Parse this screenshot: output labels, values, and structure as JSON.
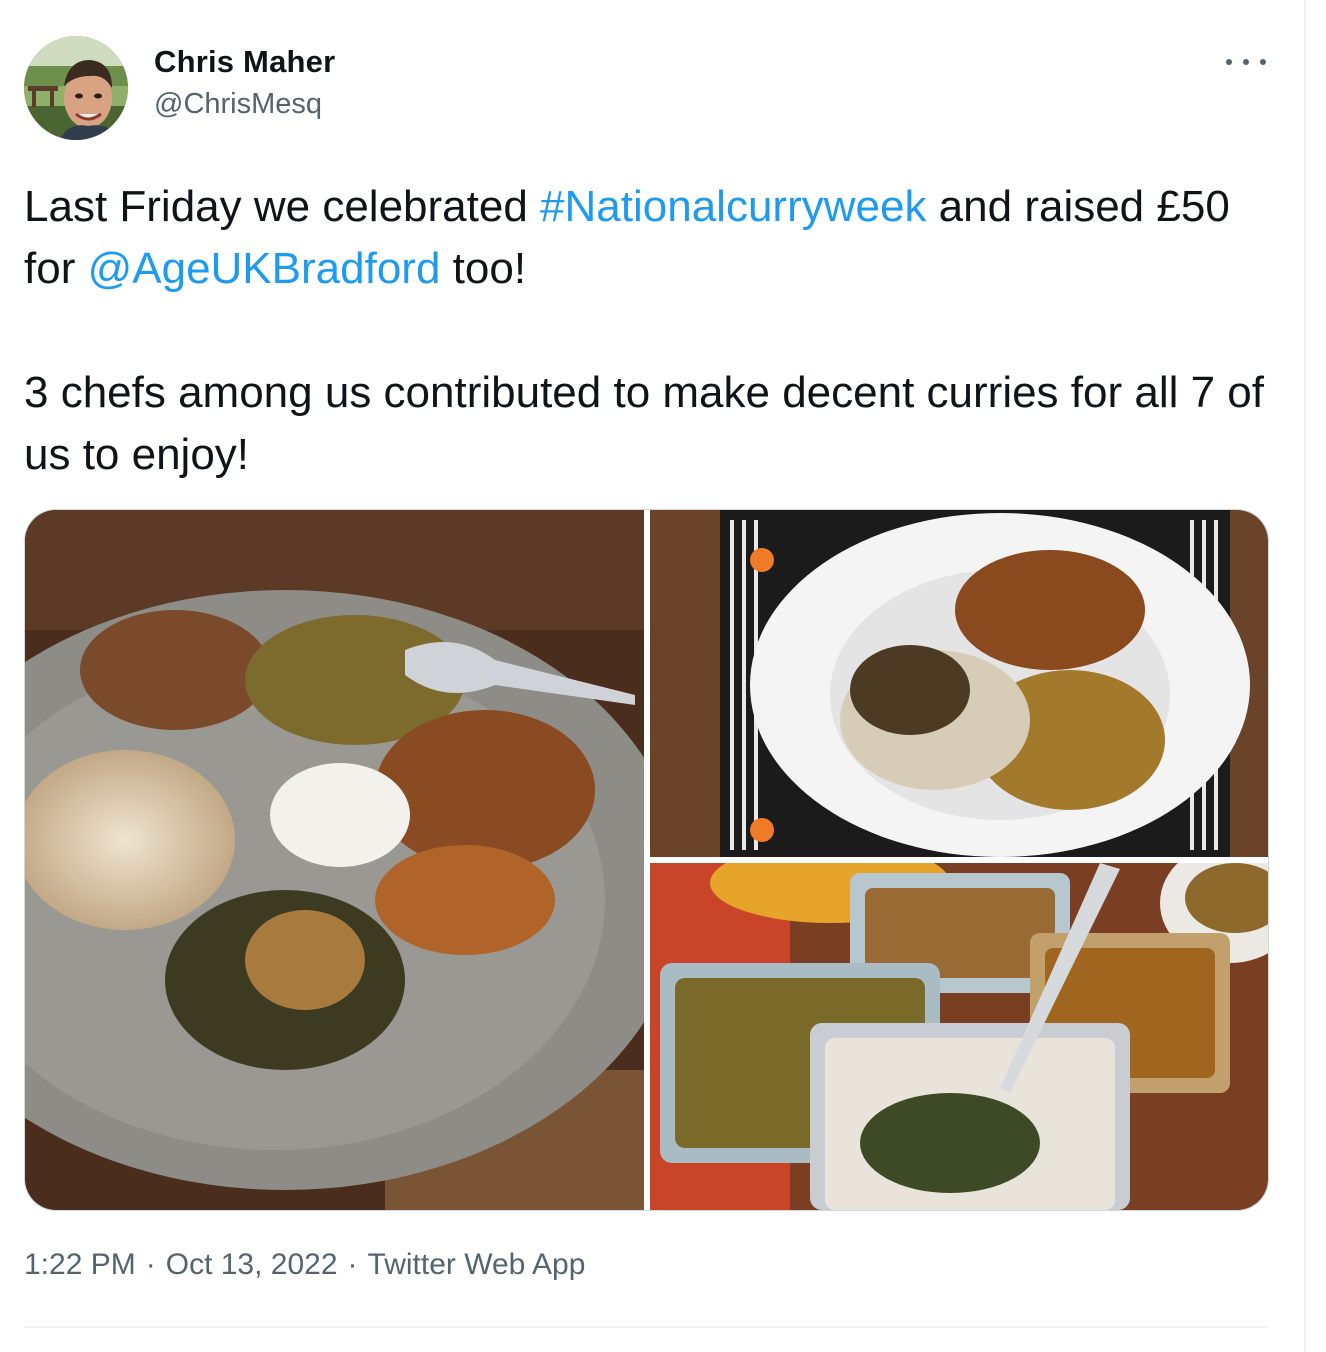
{
  "author": {
    "name": "Chris Maher",
    "handle": "@ChrisMesq"
  },
  "tweet": {
    "line1_pre": "Last Friday we celebrated ",
    "hashtag": "#Nationalcurryweek",
    "line1_post": " and raised £50 for ",
    "mention": "@AgeUKBradford",
    "line1_end": " too!",
    "paragraph2": "3 chefs among us contributed to make decent curries for all 7 of us to enjoy!"
  },
  "meta": {
    "time": "1:22 PM",
    "separator": "·",
    "date": "Oct 13, 2022",
    "source": "Twitter Web App"
  },
  "colors": {
    "link": "#1d9bf0",
    "text": "#0f1419",
    "secondary": "#536471"
  },
  "icons": {
    "more": "more-horizontal-icon"
  }
}
